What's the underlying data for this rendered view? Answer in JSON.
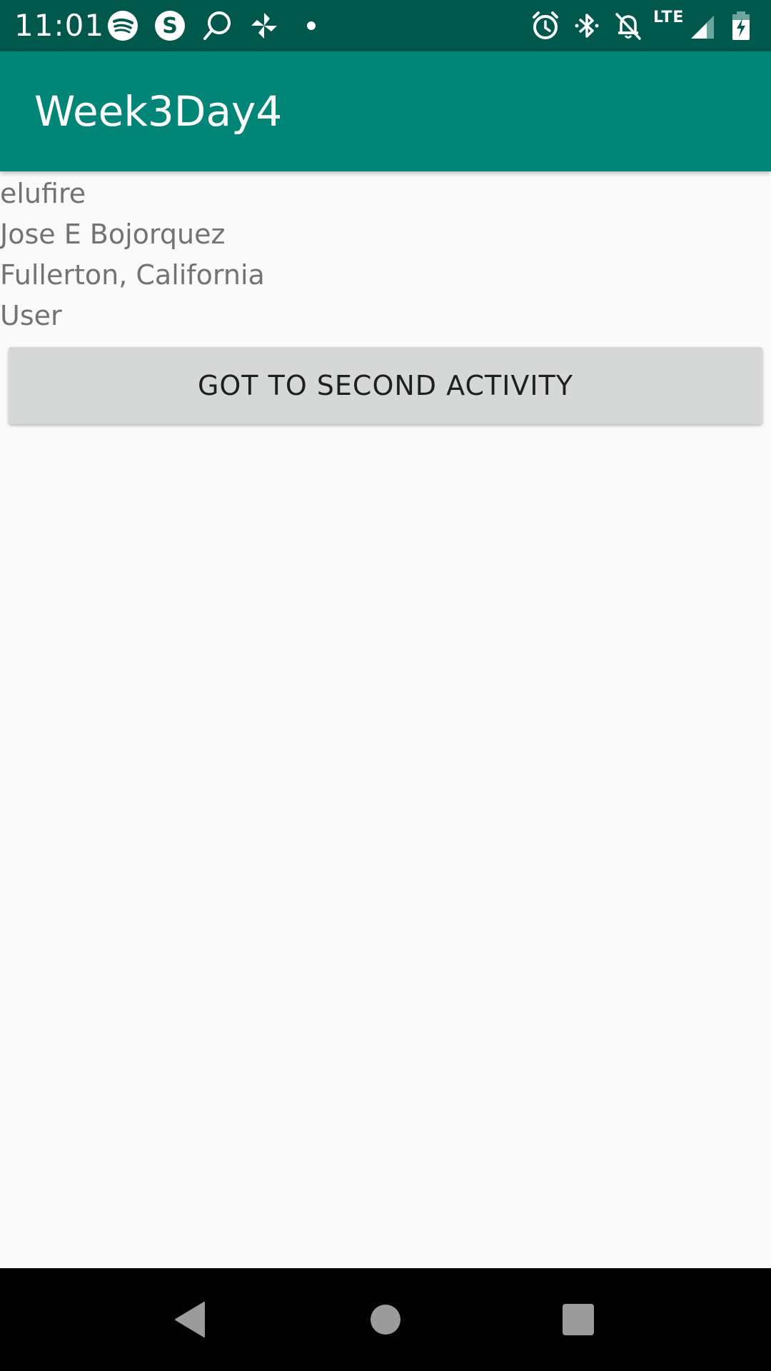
{
  "status_bar": {
    "time": "11:01",
    "network_label": "LTE",
    "background_color": "#00574b",
    "left_icons": [
      "spotify-icon",
      "skype-icon",
      "search-chat-icon",
      "pinwheel-icon",
      "dot-icon"
    ],
    "right_icons": [
      "alarm-icon",
      "bluetooth-icon",
      "notifications-off-icon",
      "signal-icon",
      "battery-charging-icon"
    ]
  },
  "app_bar": {
    "title": "Week3Day4",
    "background_color": "#008577"
  },
  "content": {
    "lines": [
      "elufire",
      "Jose E Bojorquez",
      "Fullerton, California",
      "User"
    ],
    "button_label": "GOT TO SECOND ACTIVITY"
  },
  "nav_bar": {
    "buttons": [
      "back-icon",
      "home-icon",
      "recents-icon"
    ]
  }
}
